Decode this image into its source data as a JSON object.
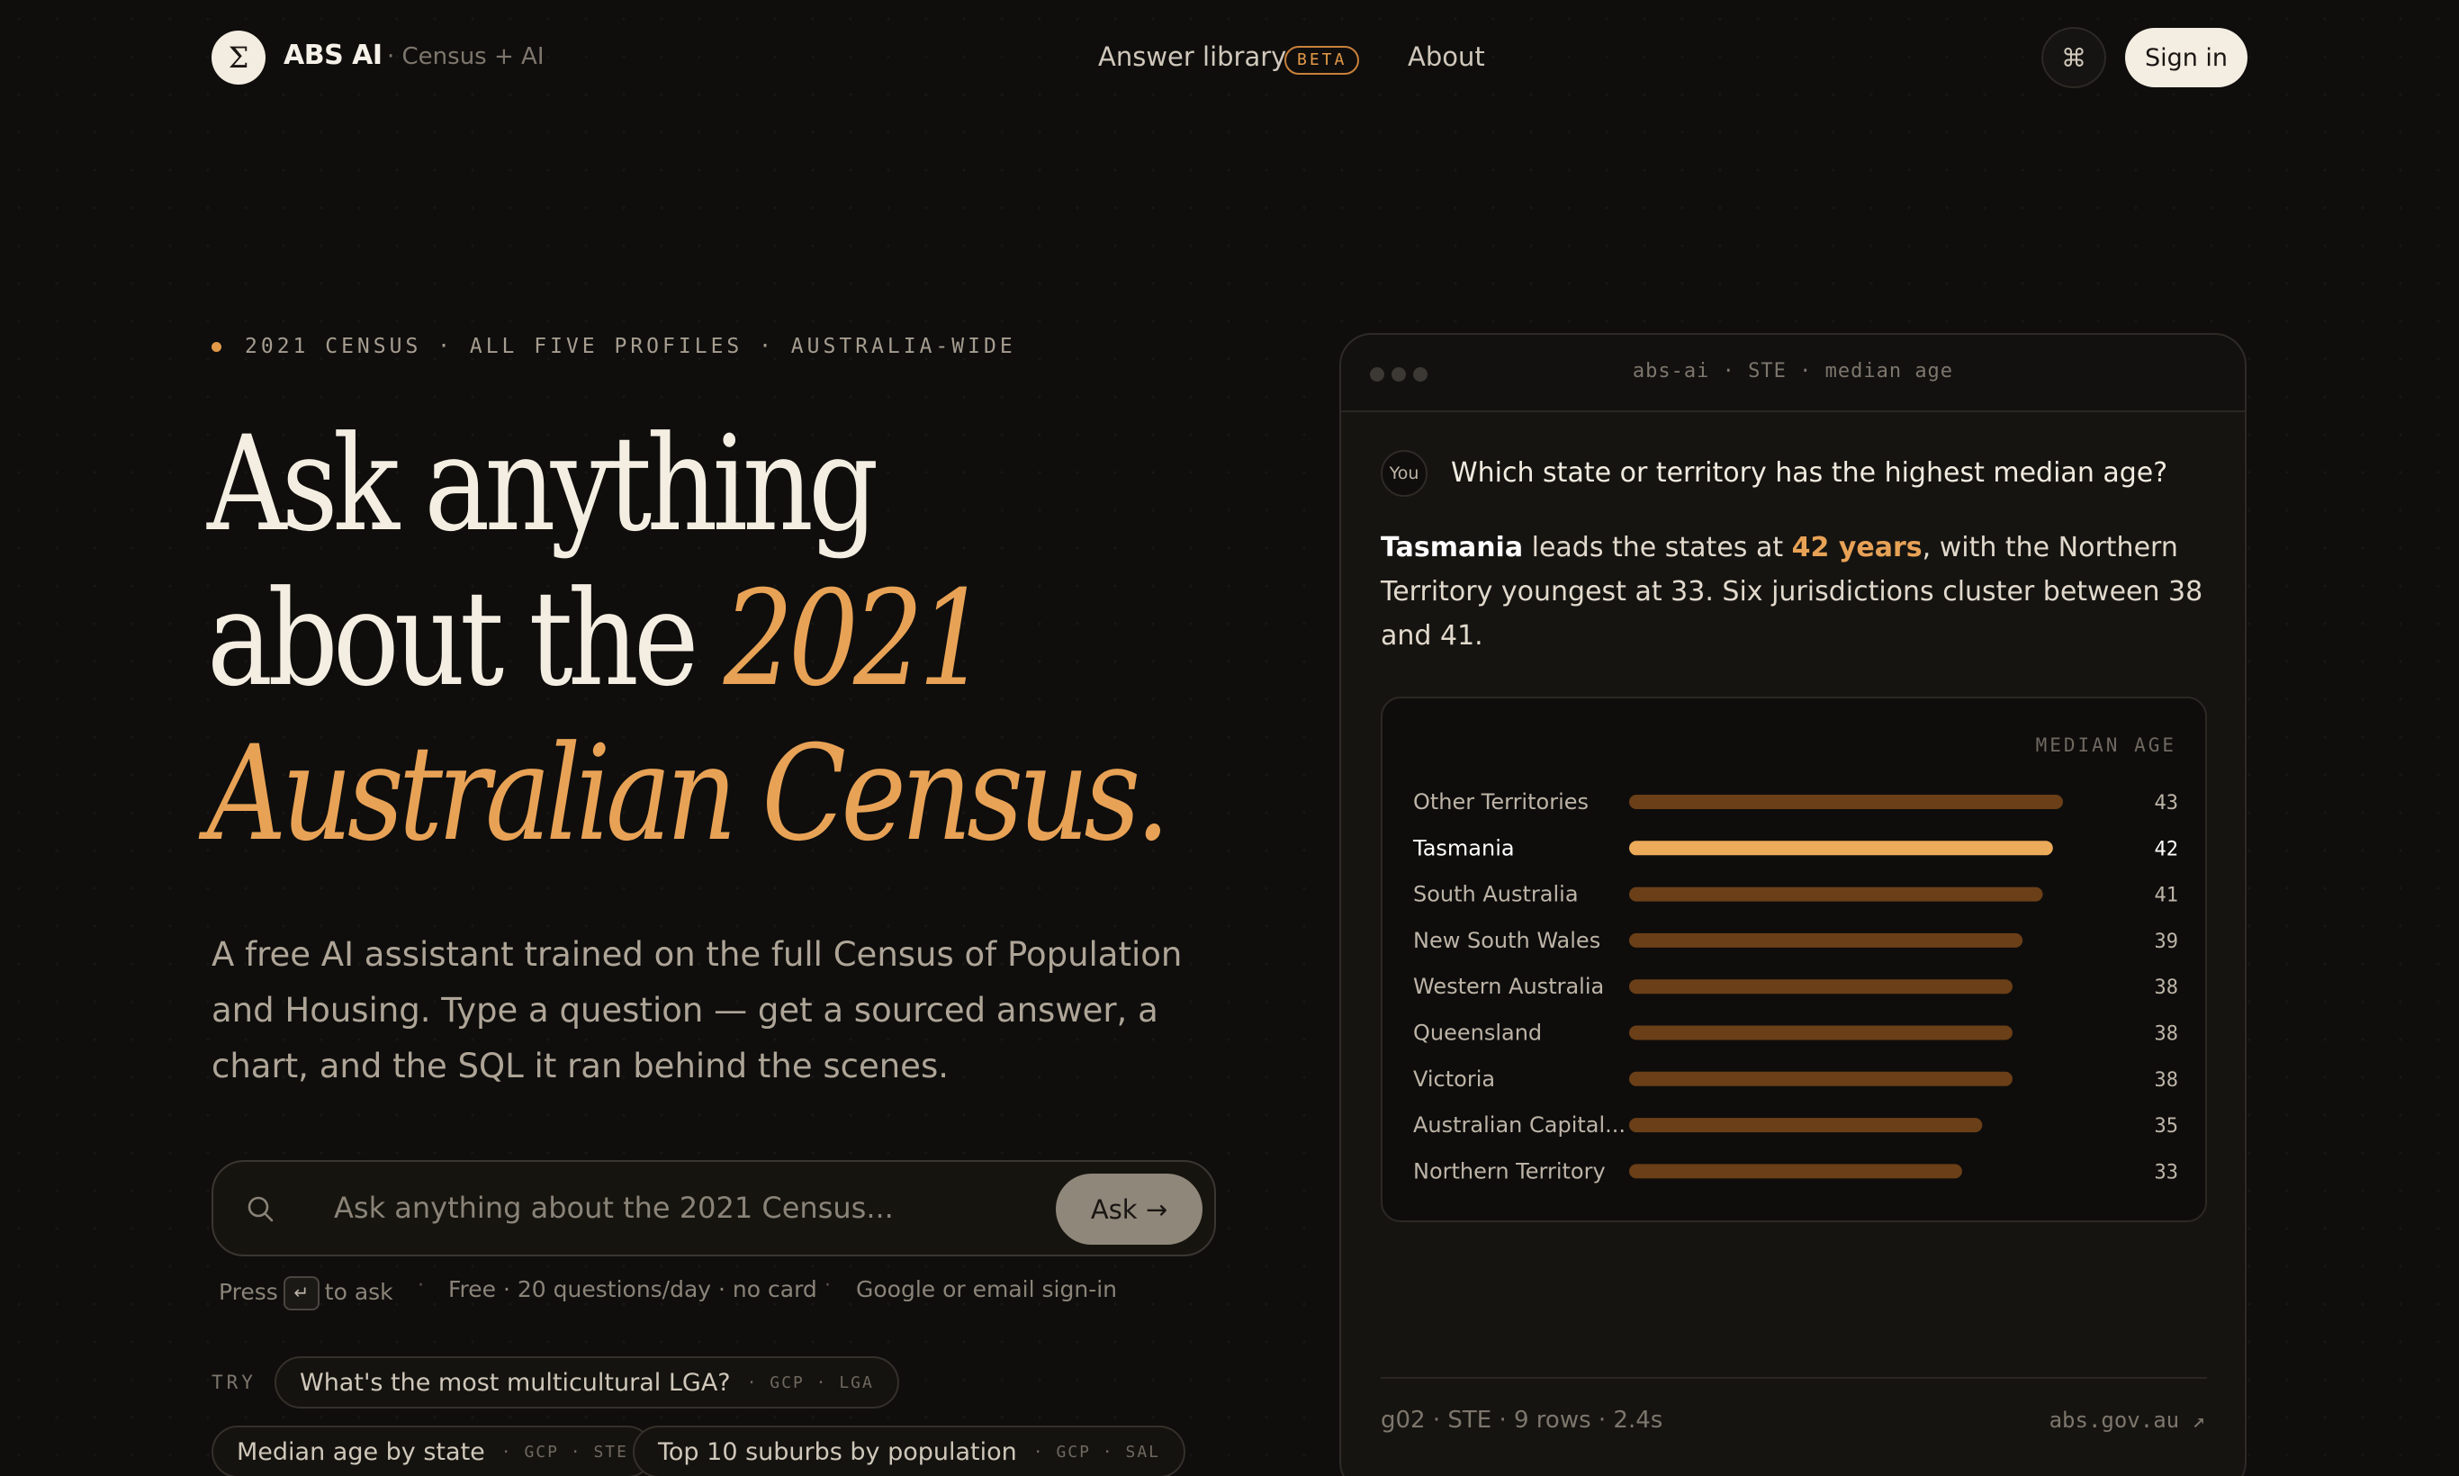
{
  "nav": {
    "logo_glyph": "Σ",
    "brand": "ABS AI",
    "brand_sub": "· Census + AI",
    "answer_library": "Answer library",
    "beta": "BETA",
    "about": "About",
    "cmd_glyph": "⌘",
    "sign_in": "Sign in"
  },
  "hero": {
    "eyebrow": "2021 CENSUS · ALL FIVE PROFILES · AUSTRALIA-WIDE",
    "headline_1": "Ask anything",
    "headline_2a": "about the ",
    "headline_2b": "2021",
    "headline_3": "Australian Census.",
    "lede": "A free AI assistant trained on the full Census of Population and Housing. Type a question — get a sourced answer, a chart, and the SQL it ran behind the scenes.",
    "search_placeholder": "Ask anything about the 2021 Census...",
    "ask_button": "Ask →",
    "hint_press": "Press",
    "hint_key": "↵",
    "hint_to_ask": "to ask",
    "hint_free": "Free · 20 questions/day · no card",
    "hint_signin": "Google or email sign-in",
    "try_label": "TRY",
    "chips": [
      {
        "q": "What's the most multicultural LGA?",
        "tag": "· GCP · LGA"
      },
      {
        "q": "Median age by state",
        "tag": "· GCP · STE"
      },
      {
        "q": "Top 10 suburbs by population",
        "tag": "· GCP · SAL"
      }
    ]
  },
  "card": {
    "title": "abs-ai · STE · median age",
    "you": "You",
    "question": "Which state or territory has the highest median age?",
    "answer_bold": "Tasmania",
    "answer_1": " leads the states at ",
    "answer_hl": "42 years",
    "answer_2": ", with the Northern Territory youngest at 33. Six jurisdictions cluster between 38 and 41.",
    "footer_meta": "g02 · STE · 9 rows · 2.4s",
    "footer_link": "abs.gov.au ↗"
  },
  "chart_data": {
    "type": "bar",
    "orientation": "horizontal",
    "title": "MEDIAN AGE",
    "categories": [
      "Other Territories",
      "Tasmania",
      "South Australia",
      "New South Wales",
      "Western Australia",
      "Queensland",
      "Victoria",
      "Australian Capital...",
      "Northern Territory"
    ],
    "values": [
      43,
      42,
      41,
      39,
      38,
      38,
      38,
      35,
      33
    ],
    "highlight": "Tasmania",
    "colors": {
      "bar": "#6b3f17",
      "highlight": "#ecab5a",
      "label": "#bdb4a7",
      "highlight_label": "#ffffff"
    },
    "xlim": [
      0,
      43
    ]
  }
}
